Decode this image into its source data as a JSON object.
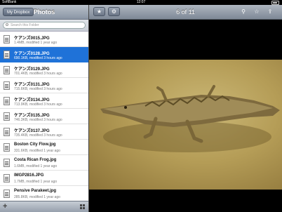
{
  "status": {
    "carrier": "SoftBank",
    "time": "12:07"
  },
  "sidebar": {
    "back_label": "My Dropbox",
    "title": "Photos",
    "search_placeholder": "Search this Folder",
    "files": [
      {
        "name": "ケアンズ0015.JPG",
        "meta": "1.4MB, modified 1 year ago",
        "selected": false
      },
      {
        "name": "ケアンズ0128.JPG",
        "meta": "690.1KB, modified 3 hours ago",
        "selected": true
      },
      {
        "name": "ケアンズ0129.JPG",
        "meta": "701.4KB, modified 3 hours ago",
        "selected": false
      },
      {
        "name": "ケアンズ0131.JPG",
        "meta": "715.6KB, modified 3 hours ago",
        "selected": false
      },
      {
        "name": "ケアンズ0134.JPG",
        "meta": "713.9KB, modified 3 hours ago",
        "selected": false
      },
      {
        "name": "ケアンズ0135.JPG",
        "meta": "746.3KB, modified 3 hours ago",
        "selected": false
      },
      {
        "name": "ケアンズ0137.JPG",
        "meta": "735.4KB, modified 3 hours ago",
        "selected": false
      },
      {
        "name": "Boston City Flow.jpg",
        "meta": "331.6KB, modified 1 year ago",
        "selected": false
      },
      {
        "name": "Costa Rican Frog.jpg",
        "meta": "1.6MB, modified 1 year ago",
        "selected": false
      },
      {
        "name": "IMGP2816.JPG",
        "meta": "1.7MB, modified 1 year ago",
        "selected": false
      },
      {
        "name": "Pensive Parakeet.jpg",
        "meta": "285.8KB, modified 1 year ago",
        "selected": false
      }
    ],
    "add_icon": "plus-icon",
    "view_icon": "grid-icon"
  },
  "toolbar": {
    "counter": "6 of 11",
    "icons": [
      "star-sidebar-icon",
      "gear-icon",
      "link-icon",
      "star-icon",
      "share-icon"
    ]
  },
  "viewer": {
    "image_subject": "crocodile photo"
  }
}
